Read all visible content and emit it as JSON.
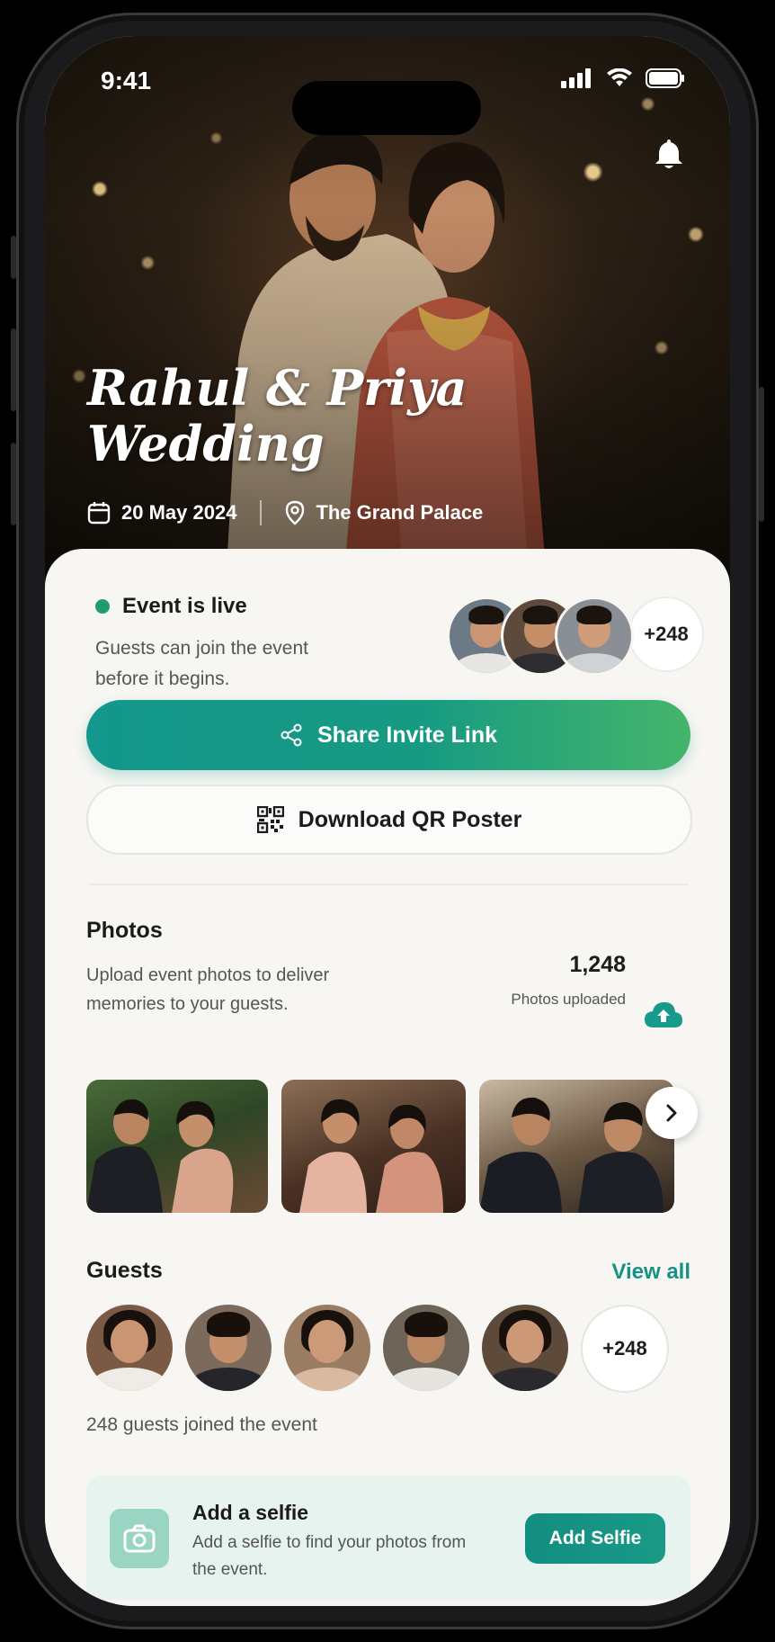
{
  "status_bar": {
    "time": "9:41"
  },
  "event": {
    "title_line1": "Rahul & Priya",
    "title_line2": "Wedding",
    "date": "20 May 2024",
    "venue": "The Grand Palace"
  },
  "live": {
    "title": "Event is live",
    "description": "Guests can join the event before it begins.",
    "extra_count": "+248"
  },
  "actions": {
    "share_label": "Share Invite Link",
    "qr_label": "Download QR Poster"
  },
  "photos": {
    "title": "Photos",
    "description": "Upload event photos to deliver memories to your guests.",
    "count": "1,248",
    "count_label": "Photos uploaded"
  },
  "guests": {
    "title": "Guests",
    "view_all": "View all",
    "extra_count": "+248",
    "joined_text": "248 guests joined the event"
  },
  "selfie": {
    "title": "Add a selfie",
    "description": "Add a selfie to find your photos from the event.",
    "button_label": "Add Selfie"
  },
  "colors": {
    "accent": "#14978c",
    "live_dot": "#1f9c6b",
    "selfie_bg": "#e7f3ef"
  },
  "icons": [
    "bell-icon",
    "calendar-icon",
    "location-pin-icon",
    "share-icon",
    "qr-code-icon",
    "cloud-upload-icon",
    "chevron-right-icon",
    "camera-icon"
  ]
}
